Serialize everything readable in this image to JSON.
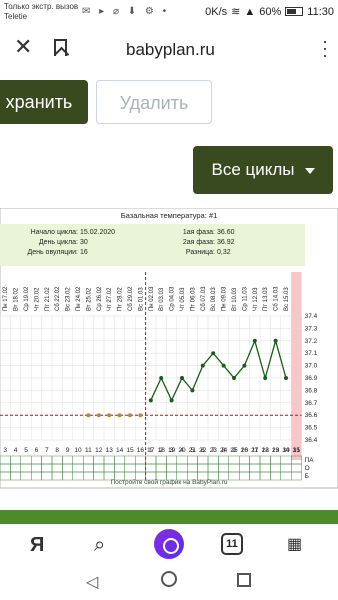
{
  "status": {
    "carrier_line1": "Только экстр. вызов",
    "carrier_line2": "Teletie",
    "net": "0K/s",
    "battery": "60%",
    "time": "11:30"
  },
  "browser": {
    "url": "babyplan.ru"
  },
  "actions": {
    "save": "хранить",
    "delete": "Удалить",
    "all_cycles": "Все циклы"
  },
  "chart_data": {
    "type": "line",
    "title": "Базальная температура: #1",
    "info_left": [
      [
        "Начало цикла:",
        "15.02.2020"
      ],
      [
        "День цикла:",
        "30"
      ],
      [
        "День овуляции:",
        "16"
      ]
    ],
    "info_right": [
      [
        "1ая фаза:",
        "36.60"
      ],
      [
        "2ая фаза:",
        "36.92"
      ],
      [
        "Разница:",
        "0,32"
      ]
    ],
    "dates": [
      "Пн 17.02",
      "Вт 18.02",
      "Ср 19.02",
      "Чт 20.02",
      "Пт 21.02",
      "Сб 22.02",
      "Вс 23.02",
      "Пн 24.02",
      "Вт 25.02",
      "Ср 26.02",
      "Чт 27.02",
      "Пт 28.02",
      "Сб 29.02",
      "Вс 01.03",
      "Пн 02.03",
      "Вт 03.03",
      "Ср 04.03",
      "Чт 05.03",
      "Пт 06.03",
      "Сб 07.03",
      "Вс 08.03",
      "Пн 09.03",
      "Вт 10.03",
      "Ср 11.03",
      "Чт 12.03",
      "Пт 13.03",
      "Сб 14.03",
      "Вс 15.03",
      "Пн 16.03"
    ],
    "days": [
      "3",
      "4",
      "5",
      "6",
      "7",
      "8",
      "9",
      "10",
      "11",
      "12",
      "13",
      "14",
      "15",
      "16",
      "17",
      "18",
      "19",
      "20",
      "21",
      "22",
      "23",
      "24",
      "25",
      "26",
      "27",
      "28",
      "29",
      "30",
      "31"
    ],
    "cycle_days_bottom": [
      "",
      "",
      "",
      "",
      "",
      "",
      "",
      "",
      "",
      "",
      "",
      "",
      "",
      "",
      "1",
      "2",
      "3",
      "4",
      "5",
      "6",
      "7",
      "8",
      "9",
      "10",
      "11",
      "12",
      "13",
      "14",
      "15"
    ],
    "y_ticks": [
      "37.4",
      "37.3",
      "37.2",
      "37.1",
      "37.0",
      "36.9",
      "36.8",
      "36.7",
      "36.6",
      "36.5",
      "36.4"
    ],
    "ylim": [
      36.4,
      37.4
    ],
    "values": [
      null,
      null,
      null,
      null,
      null,
      null,
      null,
      null,
      36.6,
      36.6,
      36.6,
      36.6,
      36.6,
      36.6,
      36.72,
      36.9,
      36.72,
      36.9,
      36.8,
      37.0,
      37.1,
      37.0,
      36.9,
      37.0,
      37.2,
      36.9,
      37.2,
      36.9,
      null
    ],
    "cover_line": 36.6,
    "ovulation_index": 13.5,
    "row_labels": [
      "ПА",
      "О",
      "Б"
    ],
    "footer": "Постройте свой график на BabyPlan.ru",
    "line_color": "#1a5d1a"
  },
  "appbar": {
    "yandex": "Я",
    "tabs": "11"
  }
}
